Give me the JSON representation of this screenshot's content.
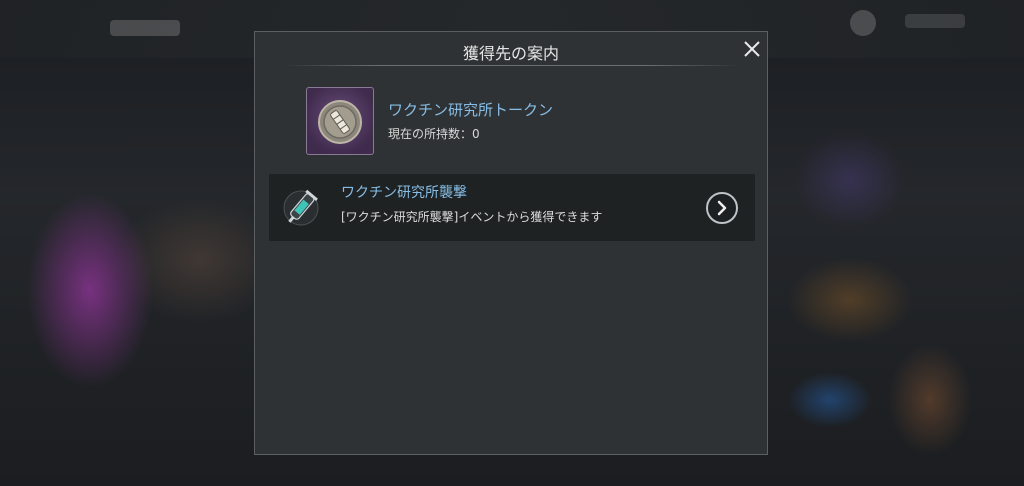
{
  "dialog": {
    "title": "獲得先の案内",
    "close_icon": "close-icon"
  },
  "item": {
    "icon": "coin-token-icon",
    "name": "ワクチン研究所トークン",
    "count_text": "現在の所持数：0"
  },
  "source": {
    "icon": "vaccine-syringe-icon",
    "name": "ワクチン研究所襲撃",
    "description": "[ワクチン研究所襲撃]イベントから獲得できます",
    "action_icon": "chevron-right-icon"
  },
  "colors": {
    "accent_text": "#86bde6",
    "item_frame": "#6a4d7c",
    "panel": "#2f3335"
  }
}
